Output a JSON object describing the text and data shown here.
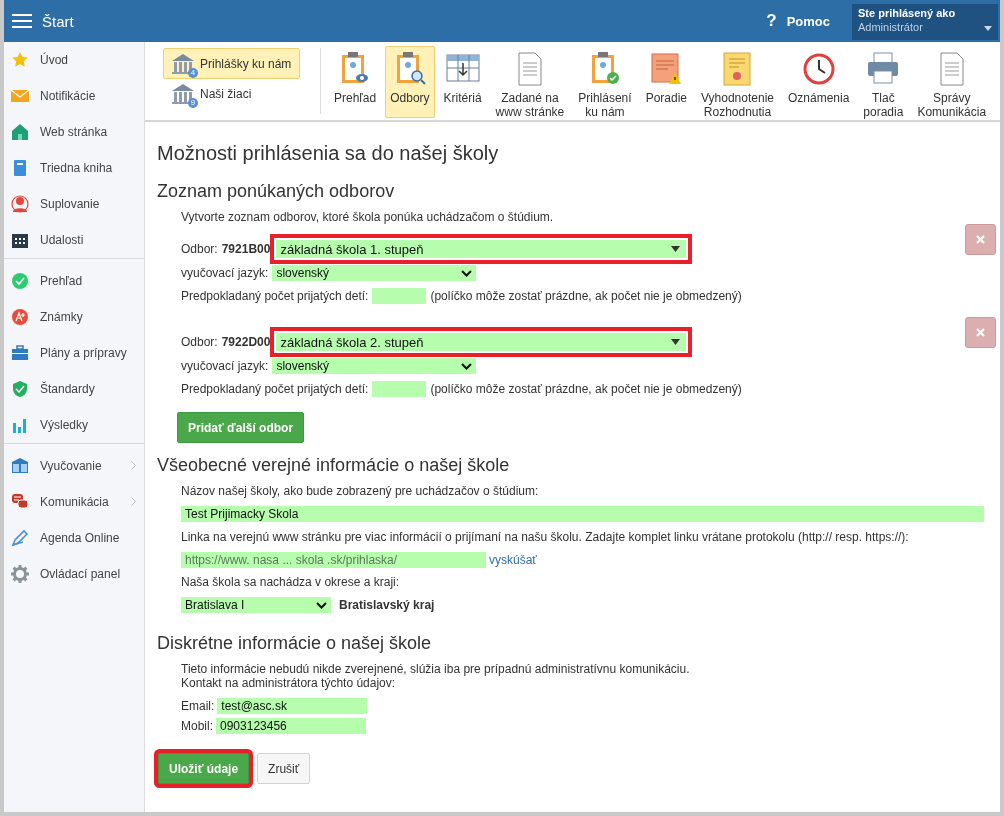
{
  "topbar": {
    "title": "Štart",
    "help": "Pomoc",
    "help_icon": "?",
    "user_caption": "Ste prihlásený ako",
    "user_name": "Administrátor"
  },
  "sidebar": {
    "groups": [
      {
        "items": [
          {
            "label": "Úvod",
            "expandable": false
          },
          {
            "label": "Notifikácie",
            "expandable": false
          },
          {
            "label": "Web stránka",
            "expandable": false
          },
          {
            "label": "Triedna kniha",
            "expandable": false
          },
          {
            "label": "Suplovanie",
            "expandable": false
          },
          {
            "label": "Udalosti",
            "expandable": false
          }
        ]
      },
      {
        "items": [
          {
            "label": "Prehľad",
            "expandable": false
          },
          {
            "label": "Známky",
            "expandable": false
          },
          {
            "label": "Plány a prípravy",
            "expandable": false
          },
          {
            "label": "Štandardy",
            "expandable": false
          },
          {
            "label": "Výsledky",
            "expandable": false
          }
        ]
      },
      {
        "items": [
          {
            "label": "Vyučovanie",
            "expandable": true
          },
          {
            "label": "Komunikácia",
            "expandable": true
          },
          {
            "label": "Agenda Online",
            "expandable": false
          },
          {
            "label": "Ovládací panel",
            "expandable": false
          }
        ]
      }
    ]
  },
  "toolbar": {
    "sections": [
      {
        "label": "Prihlášky ku nám",
        "badge": "4",
        "selected": true
      },
      {
        "label": "Naši žiaci",
        "badge": "9",
        "selected": false
      }
    ],
    "tools": [
      {
        "label": "Prehľad",
        "selected": false
      },
      {
        "label": "Odbory",
        "selected": true
      },
      {
        "label": "Kritériá",
        "selected": false
      },
      {
        "label": "Zadané na\nwww stránke",
        "selected": false
      },
      {
        "label": "Prihlásení\nku nám",
        "selected": false
      },
      {
        "label": "Poradie",
        "selected": false
      },
      {
        "label": "Vyhodnotenie\nRozhodnutia",
        "selected": false
      },
      {
        "label": "Oznámenia",
        "selected": false
      },
      {
        "label": "Tlač\nporadia",
        "selected": false
      },
      {
        "label": "Správy\nKomunikácia",
        "selected": false
      }
    ]
  },
  "page_title": "Možnosti prihlásenia sa do našej školy",
  "programs": {
    "heading": "Zoznam ponúkaných odborov",
    "intro": "Vytvorte zoznam odborov, ktoré škola ponúka uchádzačom o štúdium.",
    "items": [
      {
        "label": "Odbor:",
        "code": "7921B00",
        "value": "základná škola 1. stupeň",
        "highlighted": true,
        "language_label": "vyučovací jazyk:",
        "language": "slovenský",
        "count_label": "Predpokladaný počet prijatých detí:",
        "count_note": "(políčko môže zostať prázdne, ak počet nie je obmedzený)"
      },
      {
        "label": "Odbor:",
        "code": "7922D00",
        "value": "základná škola 2. stupeň",
        "highlighted": true,
        "language_label": "vyučovací jazyk:",
        "language": "slovenský",
        "count_label": "Predpokladaný počet prijatých detí:",
        "count_note": "(políčko môže zostať prázdne, ak počet nie je obmedzený)"
      }
    ],
    "add_button": "Pridať ďalší odbor"
  },
  "public_info": {
    "heading": "Všeobecné verejné informácie o našej škole",
    "name_label": "Názov našej školy, ako bude zobrazený pre uchádzačov o štúdium:",
    "name_value": "Test Prijimacky Skola",
    "link_label": "Linka na verejnú www stránku pre viac informácií o prijímaní na našu školu. Zadajte komplet linku vrátane protokolu (http:// resp. https://):",
    "link_placeholder": "https://www. nasa ... skola .sk/prihlaska/",
    "link_test": "vyskúšať",
    "region_label": "Naša škola sa nachádza v okrese a kraji:",
    "district": "Bratislava I",
    "region": "Bratislavský kraj"
  },
  "private_info": {
    "heading": "Diskrétne informácie o našej škole",
    "note": "Tieto informácie nebudú nikde zverejnené, slúžia iba pre prípadnú administratívnu komunikáciu.\nKontakt na administrátora týchto údajov:",
    "fields": [
      {
        "label": "Email:",
        "value": "test@asc.sk"
      },
      {
        "label": "Mobil:",
        "value": "0903123456"
      }
    ]
  },
  "actions": [
    {
      "label": "Uložiť údaje",
      "kind": "primary",
      "highlighted": true
    },
    {
      "label": "Zrušiť",
      "kind": "secondary",
      "highlighted": false
    }
  ]
}
